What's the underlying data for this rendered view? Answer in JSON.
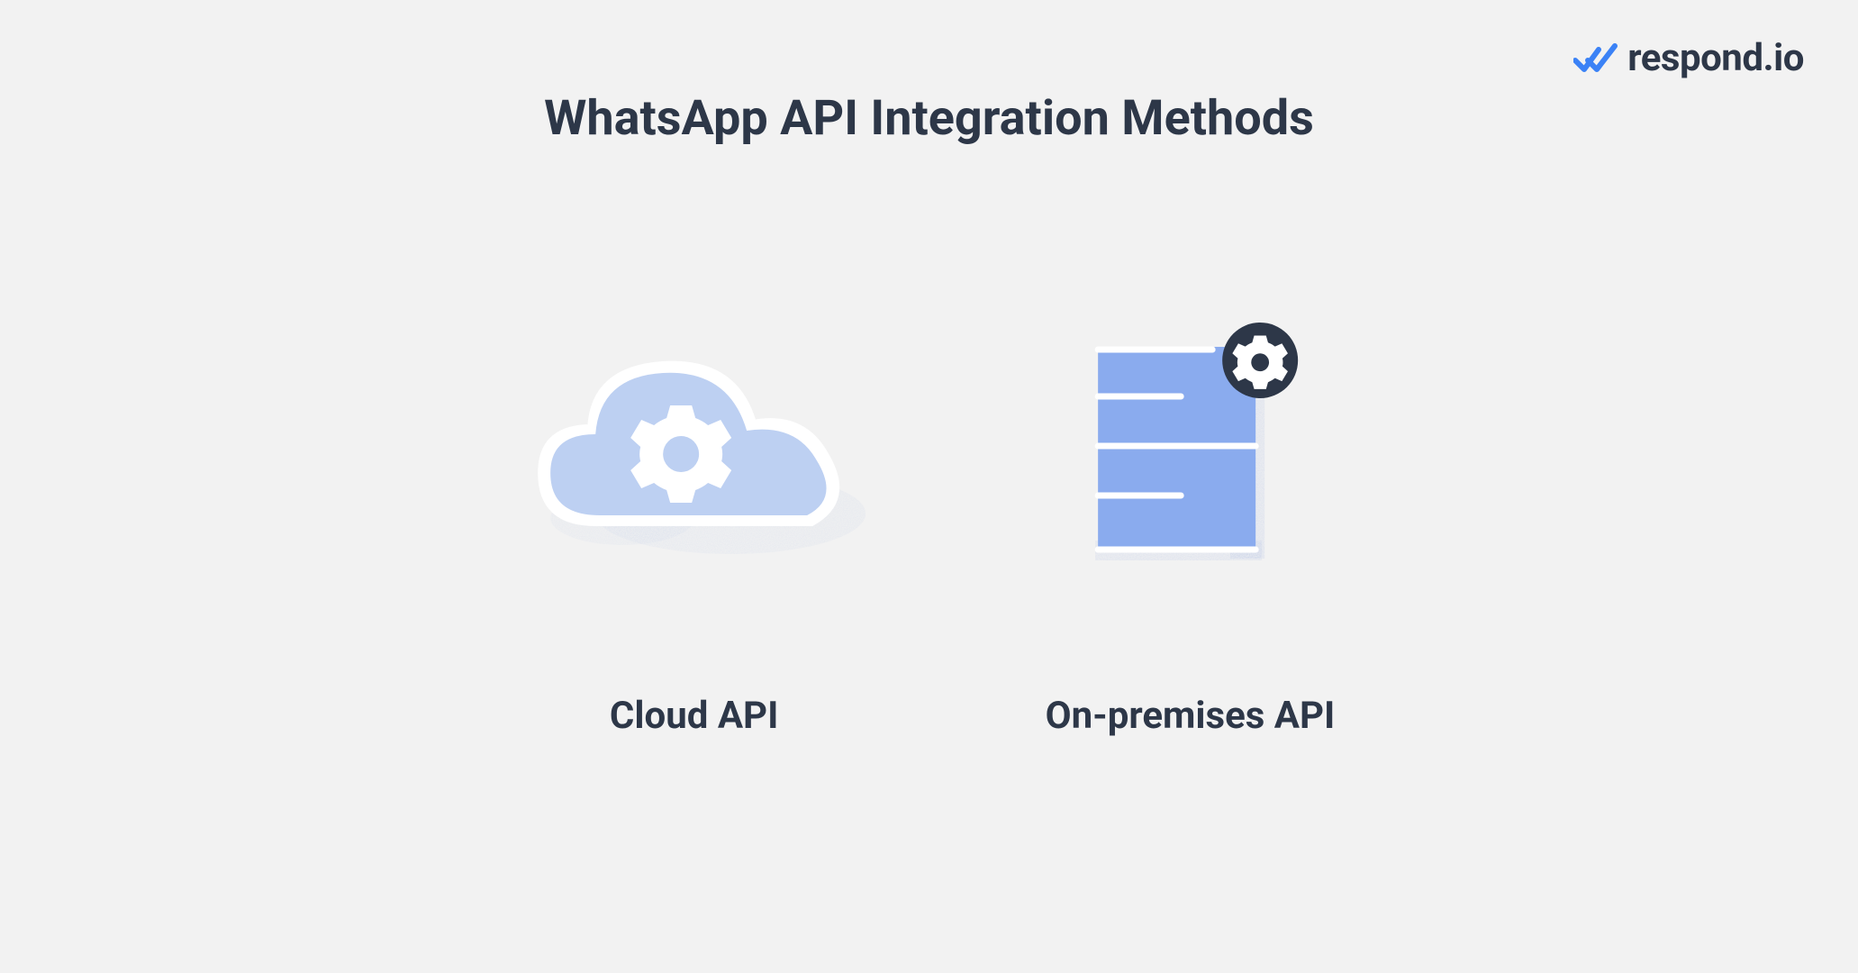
{
  "logo": {
    "text": "respond.io"
  },
  "title": "WhatsApp API Integration Methods",
  "cards": [
    {
      "label": "Cloud API",
      "icon": "cloud-gear"
    },
    {
      "label": "On-premises API",
      "icon": "server-gear"
    }
  ],
  "colors": {
    "background": "#f2f2f2",
    "text": "#2d3748",
    "cloudFill": "#bdd0f2",
    "cloudShadow": "#7d9ed6",
    "serverFill": "#8aabee",
    "accentBlue": "#3b82f6",
    "gearBadge": "#2d3748"
  }
}
